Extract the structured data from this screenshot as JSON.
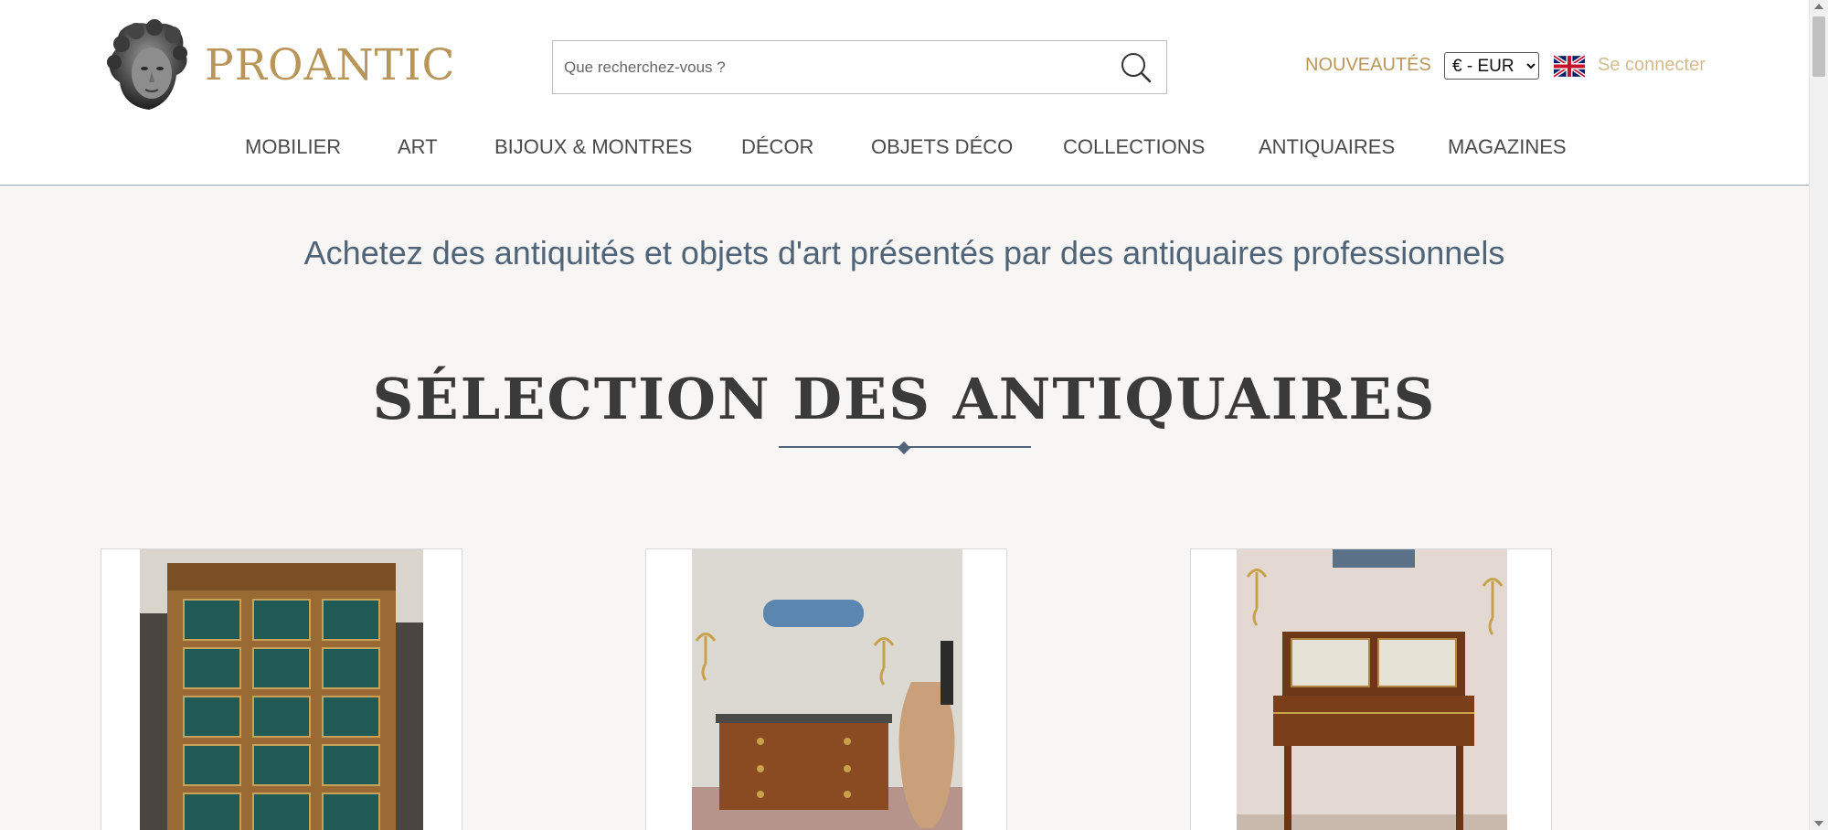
{
  "header": {
    "brand": "PROANTIC",
    "search": {
      "placeholder": "Que recherchez-vous ?",
      "value": ""
    },
    "nouveautes_label": "NOUVEAUTÉS",
    "currency": {
      "selected": "€ - EUR"
    },
    "login_label": "Se connecter"
  },
  "nav": {
    "items": [
      {
        "label": "MOBILIER"
      },
      {
        "label": "ART"
      },
      {
        "label": "BIJOUX & MONTRES"
      },
      {
        "label": "DÉCOR"
      },
      {
        "label": "OBJETS DÉCO"
      },
      {
        "label": "COLLECTIONS"
      },
      {
        "label": "ANTIQUAIRES"
      },
      {
        "label": "MAGAZINES"
      }
    ]
  },
  "main": {
    "tagline": "Achetez des antiquités et objets d'art présentés par des antiquaires professionnels",
    "section_title": "SÉLECTION DES ANTIQUAIRES"
  },
  "colors": {
    "brand_gold": "#b8965a",
    "accent_blue": "#4f6478",
    "background": "#f7f6f4"
  },
  "icons": {
    "search": "search-icon",
    "flag": "uk-flag-icon",
    "logo": "classical-head-logo-icon"
  }
}
